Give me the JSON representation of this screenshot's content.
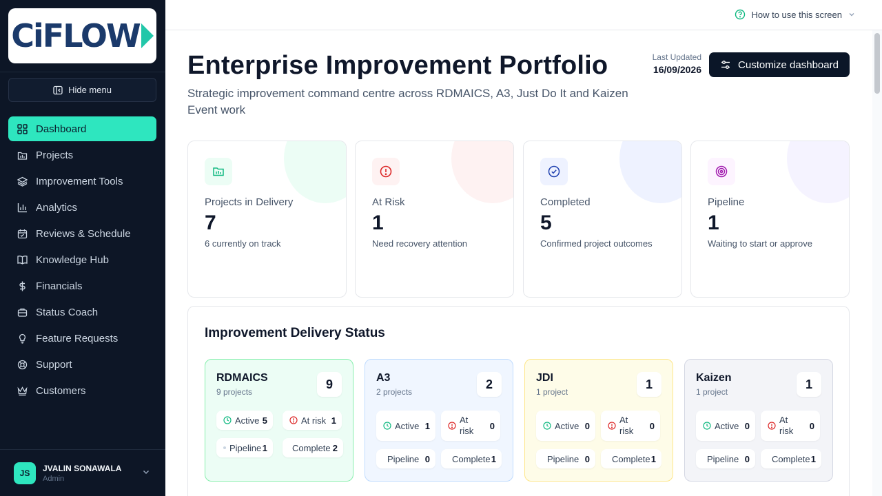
{
  "logo": {
    "text": "CiFLOW"
  },
  "sidebar": {
    "hide_menu_label": "Hide menu",
    "items": [
      {
        "label": "Dashboard",
        "icon": "grid-icon",
        "active": true
      },
      {
        "label": "Projects",
        "icon": "folder-icon"
      },
      {
        "label": "Improvement Tools",
        "icon": "layers-icon"
      },
      {
        "label": "Analytics",
        "icon": "bar-chart-icon"
      },
      {
        "label": "Reviews & Schedule",
        "icon": "calendar-icon"
      },
      {
        "label": "Knowledge Hub",
        "icon": "book-icon"
      },
      {
        "label": "Financials",
        "icon": "dollar-icon"
      },
      {
        "label": "Status Coach",
        "icon": "briefcase-icon"
      },
      {
        "label": "Feature Requests",
        "icon": "lightbulb-icon"
      },
      {
        "label": "Support",
        "icon": "lifebuoy-icon"
      },
      {
        "label": "Customers",
        "icon": "crown-icon"
      }
    ],
    "user": {
      "initials": "JS",
      "name": "JVALIN SONAWALA",
      "role": "Admin"
    }
  },
  "topbar": {
    "help_label": "How to use this screen"
  },
  "header": {
    "title": "Enterprise Improvement Portfolio",
    "subtitle": "Strategic improvement command centre across RDMAICS, A3, Just Do It and Kaizen Event work",
    "last_updated_label": "Last Updated",
    "last_updated_value": "16/09/2026",
    "customize_label": "Customize dashboard"
  },
  "kpis": [
    {
      "label": "Projects in Delivery",
      "value": "7",
      "sub": "6 currently on track",
      "icon": "delivery-icon",
      "color": "#10b981"
    },
    {
      "label": "At Risk",
      "value": "1",
      "sub": "Need recovery attention",
      "icon": "alert-icon",
      "color": "#dc2626"
    },
    {
      "label": "Completed",
      "value": "5",
      "sub": "Confirmed project outcomes",
      "icon": "check-circle-icon",
      "color": "#1e40af"
    },
    {
      "label": "Pipeline",
      "value": "1",
      "sub": "Waiting to start or approve",
      "icon": "target-icon",
      "color": "#a21caf"
    }
  ],
  "delivery_status": {
    "title": "Improvement Delivery Status",
    "methods": [
      {
        "name": "RDMAICS",
        "count_label": "9 projects",
        "total": "9",
        "active_label": "Active",
        "active": "5",
        "at_risk_label": "At risk",
        "at_risk": "1",
        "pipeline_label": "Pipeline",
        "pipeline": "1",
        "complete_label": "Complete",
        "complete": "2",
        "bg": "#ecfdf5",
        "border": "#86efac"
      },
      {
        "name": "A3",
        "count_label": "2 projects",
        "total": "2",
        "active_label": "Active",
        "active": "1",
        "at_risk_label": "At risk",
        "at_risk": "0",
        "pipeline_label": "Pipeline",
        "pipeline": "0",
        "complete_label": "Complete",
        "complete": "1",
        "bg": "#f0f6ff",
        "border": "#bfdbfe"
      },
      {
        "name": "JDI",
        "count_label": "1 project",
        "total": "1",
        "active_label": "Active",
        "active": "0",
        "at_risk_label": "At risk",
        "at_risk": "0",
        "pipeline_label": "Pipeline",
        "pipeline": "0",
        "complete_label": "Complete",
        "complete": "1",
        "bg": "#fefce8",
        "border": "#fde68a"
      },
      {
        "name": "Kaizen",
        "count_label": "1 project",
        "total": "1",
        "active_label": "Active",
        "active": "0",
        "at_risk_label": "At risk",
        "at_risk": "0",
        "pipeline_label": "Pipeline",
        "pipeline": "0",
        "complete_label": "Complete",
        "complete": "1",
        "bg": "#f3f4f8",
        "border": "#d4d7e3"
      }
    ]
  }
}
